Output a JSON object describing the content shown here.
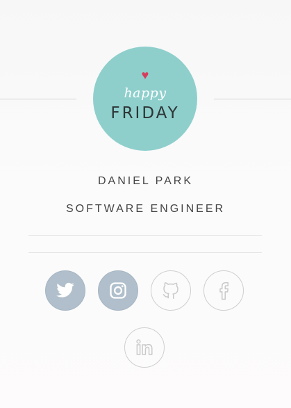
{
  "avatar": {
    "heart": "♥",
    "line1": "happy",
    "line2": "FRIDAY",
    "bg_color": "#8ecfcc",
    "heart_color": "#d73c5b"
  },
  "profile": {
    "name": "DANIEL PARK",
    "role": "SOFTWARE ENGINEER"
  },
  "social": [
    {
      "icon": "twitter-icon",
      "style": "filled"
    },
    {
      "icon": "instagram-icon",
      "style": "filled"
    },
    {
      "icon": "github-icon",
      "style": "outline"
    },
    {
      "icon": "facebook-icon",
      "style": "outline"
    },
    {
      "icon": "linkedin-icon",
      "style": "outline"
    }
  ],
  "colors": {
    "filled_icon_bg": "#b0bfcb",
    "outline_border": "#cfcfcf"
  }
}
